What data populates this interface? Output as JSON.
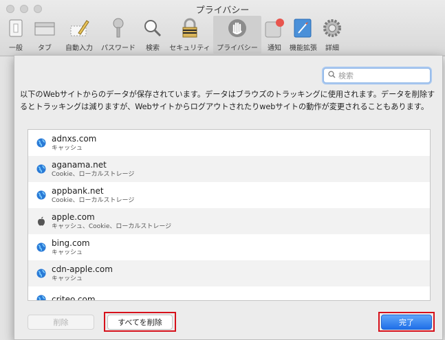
{
  "window": {
    "title": "プライバシー"
  },
  "toolbar": {
    "items": [
      {
        "label": "一般",
        "icon": "general-icon",
        "active": false
      },
      {
        "label": "タブ",
        "icon": "tabs-icon",
        "active": false
      },
      {
        "label": "自動入力",
        "icon": "autofill-icon",
        "active": false
      },
      {
        "label": "パスワード",
        "icon": "passwords-icon",
        "active": false
      },
      {
        "label": "検索",
        "icon": "search-icon",
        "active": false
      },
      {
        "label": "セキュリティ",
        "icon": "security-icon",
        "active": false
      },
      {
        "label": "プライバシー",
        "icon": "privacy-icon",
        "active": true
      },
      {
        "label": "通知",
        "icon": "notifications-icon",
        "active": false
      },
      {
        "label": "機能拡張",
        "icon": "extensions-icon",
        "active": false
      },
      {
        "label": "詳細",
        "icon": "advanced-icon",
        "active": false
      }
    ]
  },
  "sheet": {
    "search_placeholder": "検索",
    "description": "以下のWebサイトからのデータが保存されています。データはブラウズのトラッキングに使用されます。データを削除するとトラッキングは減りますが、Webサイトからログアウトされたりwebサイトの動作が変更されることもあります。",
    "sites": [
      {
        "site": "adnxs.com",
        "detail": "キャッシュ",
        "icon": "globe-icon"
      },
      {
        "site": "aganama.net",
        "detail": "Cookie、ローカルストレージ",
        "icon": "globe-icon"
      },
      {
        "site": "appbank.net",
        "detail": "Cookie、ローカルストレージ",
        "icon": "globe-icon"
      },
      {
        "site": "apple.com",
        "detail": "キャッシュ、Cookie、ローカルストレージ",
        "icon": "apple-icon"
      },
      {
        "site": "bing.com",
        "detail": "キャッシュ",
        "icon": "globe-icon"
      },
      {
        "site": "cdn-apple.com",
        "detail": "キャッシュ",
        "icon": "globe-icon"
      },
      {
        "site": "criteo.com",
        "detail": "",
        "icon": "globe-icon"
      }
    ],
    "buttons": {
      "remove": "削除",
      "remove_all": "すべてを削除",
      "done": "完了"
    }
  },
  "colors": {
    "accent": "#1f6fe8",
    "highlight_frame": "#d6101a"
  }
}
